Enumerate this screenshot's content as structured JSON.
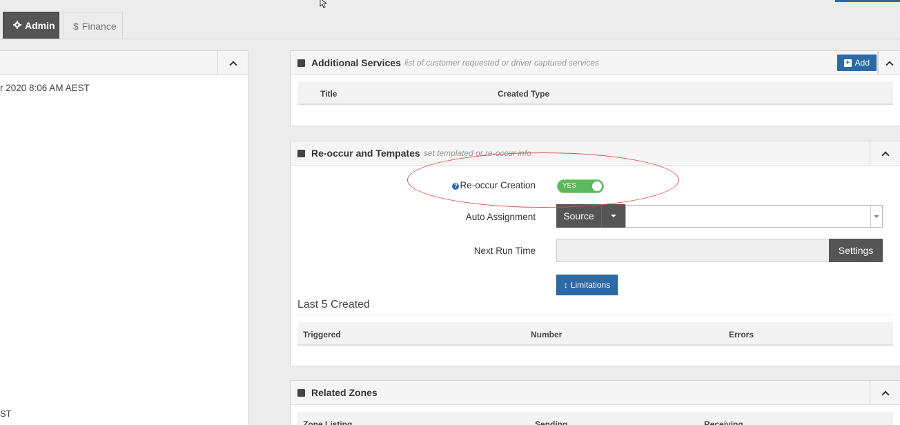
{
  "tabs": [
    {
      "label": "Admin",
      "icon": "gear-icon"
    },
    {
      "label": "Finance",
      "icon": "dollar-icon",
      "glyph": "$"
    }
  ],
  "left_panel": {
    "date_text": "r 2020 8:06 AM AEST",
    "bottom_text": "ST"
  },
  "additional_services": {
    "title": "Additional Services",
    "subtitle": "list of customer requested or driver captured services",
    "add_label": "Add",
    "columns": [
      "Title",
      "Created Type"
    ]
  },
  "reoccur": {
    "title": "Re-occur and Tempates",
    "subtitle": "set templated or re-occur info",
    "reoccur_creation_label": "Re-occur Creation",
    "toggle_value": "YES",
    "auto_assignment_label": "Auto Assignment",
    "source_label": "Source",
    "next_run_label": "Next Run Time",
    "settings_label": "Settings",
    "limitations_label": "Limitations",
    "last5_title": "Last 5 Created",
    "columns": [
      "Triggered",
      "Number",
      "Errors"
    ]
  },
  "related_zones": {
    "title": "Related Zones",
    "columns": [
      "Zone Listing",
      "Sending",
      "Receiving"
    ]
  },
  "colors": {
    "accent": "#2c6aa6",
    "toggle_on": "#5cb85c",
    "annotation": "#d9534f",
    "dark_button": "#555555"
  }
}
